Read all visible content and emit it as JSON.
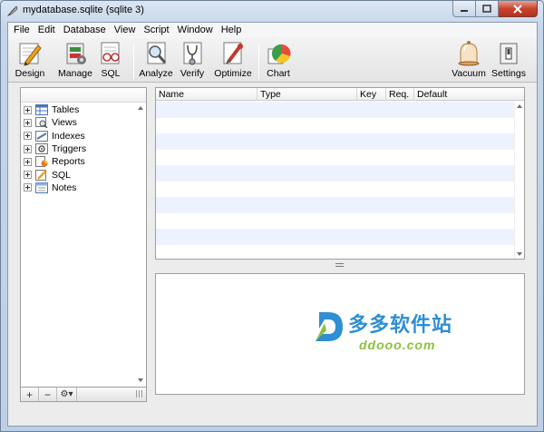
{
  "window": {
    "title": "mydatabase.sqlite (sqlite 3)"
  },
  "menu": [
    "File",
    "Edit",
    "Database",
    "View",
    "Script",
    "Window",
    "Help"
  ],
  "toolbar": {
    "design": "Design",
    "manage": "Manage",
    "sql": "SQL",
    "analyze": "Analyze",
    "verify": "Verify",
    "optimize": "Optimize",
    "chart": "Chart",
    "vacuum": "Vacuum",
    "settings": "Settings"
  },
  "tree": [
    {
      "label": "Tables",
      "icon": "table-icon"
    },
    {
      "label": "Views",
      "icon": "view-icon"
    },
    {
      "label": "Indexes",
      "icon": "index-icon"
    },
    {
      "label": "Triggers",
      "icon": "trigger-icon"
    },
    {
      "label": "Reports",
      "icon": "report-icon"
    },
    {
      "label": "SQL",
      "icon": "sql-icon"
    },
    {
      "label": "Notes",
      "icon": "notes-icon"
    }
  ],
  "bottom_bar": {
    "add": "+",
    "remove": "−",
    "gear": "⚙▾"
  },
  "table": {
    "columns": [
      "Name",
      "Type",
      "Key",
      "Req.",
      "Default"
    ]
  },
  "watermark": {
    "cn": "多多软件站",
    "en": "ddooo.com"
  },
  "colors": {
    "row_alt": "#edf3fe",
    "close_button": "#c8432d",
    "watermark_blue": "#2e8fd3",
    "watermark_green": "#8cc03c"
  }
}
